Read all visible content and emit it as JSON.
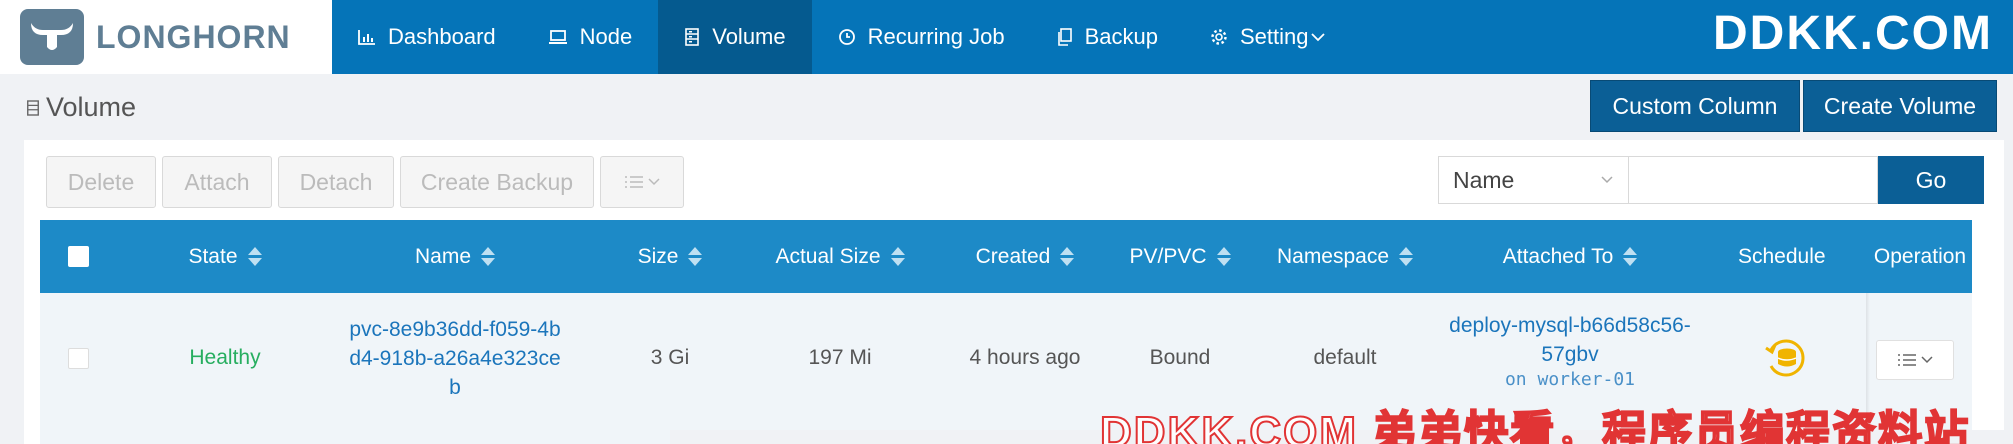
{
  "brand": {
    "name": "LONGHORN"
  },
  "nav": [
    {
      "label": "Dashboard",
      "icon": "bar-chart-icon"
    },
    {
      "label": "Node",
      "icon": "laptop-icon"
    },
    {
      "label": "Volume",
      "icon": "database-icon",
      "active": true
    },
    {
      "label": "Recurring Job",
      "icon": "clock-icon"
    },
    {
      "label": "Backup",
      "icon": "copy-icon"
    },
    {
      "label": "Setting",
      "icon": "gear-icon"
    }
  ],
  "watermark": {
    "top": "DDKK.COM",
    "bottom": "DDKK.COM 弟弟快看，程序员编程资料站"
  },
  "page": {
    "title": "Volume",
    "custom_column": "Custom Column",
    "create_volume": "Create Volume"
  },
  "toolbar": {
    "delete": "Delete",
    "attach": "Attach",
    "detach": "Detach",
    "create_backup": "Create Backup",
    "filter_field": "Name",
    "search_value": "",
    "go": "Go"
  },
  "table": {
    "columns": [
      "State",
      "Name",
      "Size",
      "Actual Size",
      "Created",
      "PV/PVC",
      "Namespace",
      "Attached To",
      "Schedule",
      "Operation"
    ],
    "rows": [
      {
        "state": "Healthy",
        "name_line1": "pvc-8e9b36dd-f059-4b",
        "name_line2": "d4-918b-a26a4e323ce",
        "name_line3": "b",
        "size": "3 Gi",
        "actual_size": "197 Mi",
        "created": "4 hours ago",
        "pv_pvc": "Bound",
        "namespace": "default",
        "attached_line1": "deploy-mysql-b66d58c56-",
        "attached_line2": "57gbv",
        "attached_node": "on worker-01"
      }
    ]
  },
  "colors": {
    "header": "#0574b8",
    "active_nav": "#055a8f",
    "table_header": "#1d8ac7",
    "primary_button": "#0b5f96",
    "healthy": "#27ae60",
    "link": "#1b75bb",
    "schedule_icon": "#f0b400"
  }
}
